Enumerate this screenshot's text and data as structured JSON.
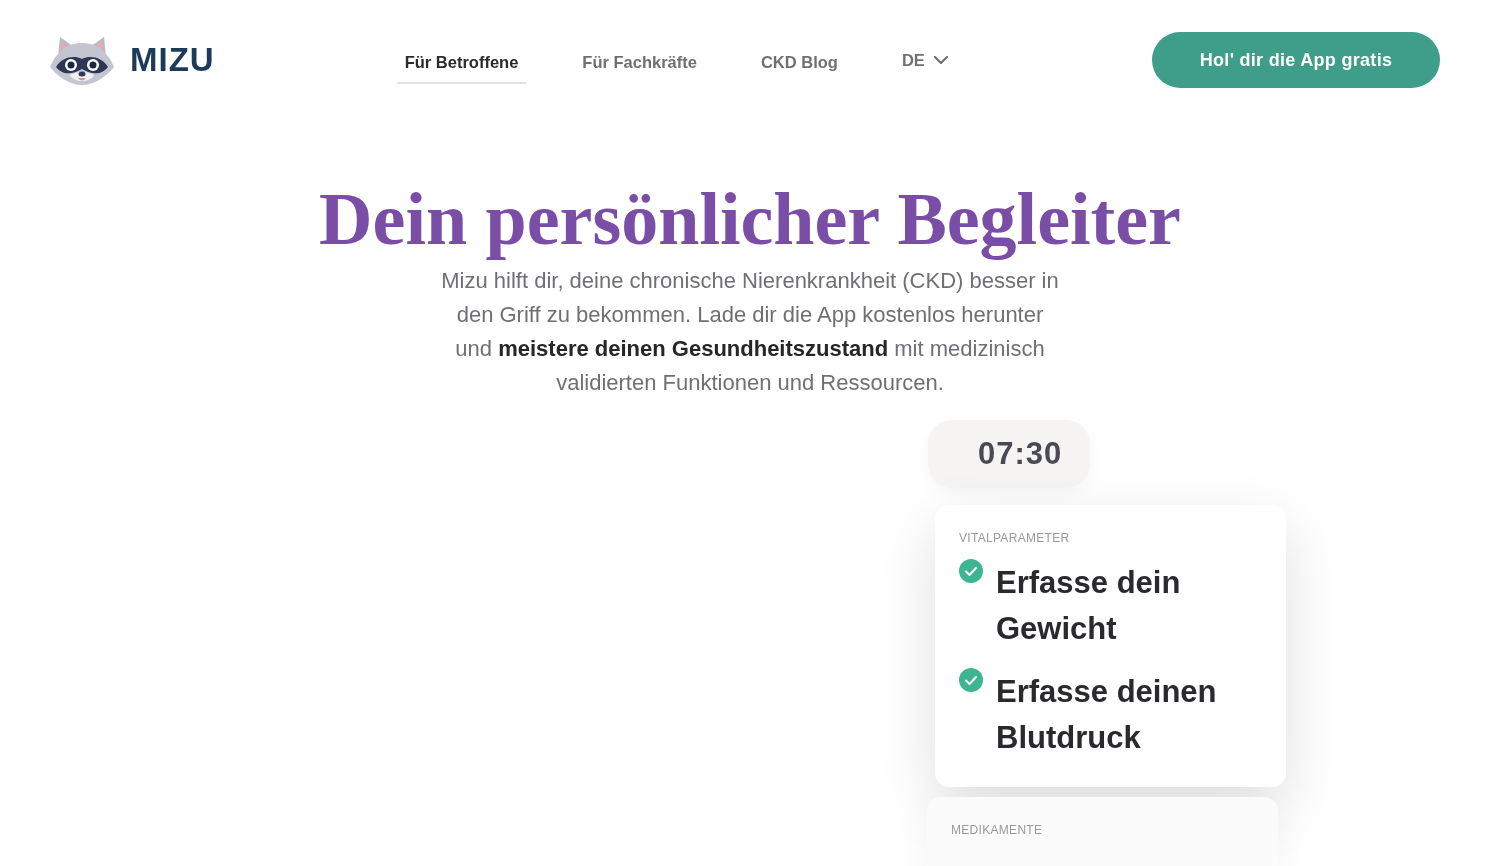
{
  "header": {
    "logo": {
      "text": "MIZU"
    },
    "nav": [
      {
        "label": "Für Betroffene",
        "selected": true
      },
      {
        "label": "Für Fachkräfte",
        "selected": false
      },
      {
        "label": "CKD Blog",
        "selected": false
      }
    ],
    "language": {
      "label": "DE"
    },
    "cta": {
      "label": "Hol' dir die App gratis"
    }
  },
  "hero": {
    "title": "Dein persönlicher Begleiter",
    "intro": "Mizu hilft dir, deine chronische Nierenkrankheit (CKD) besser in den Griff zu bekommen. Lade dir die App kostenlos herunter und **meistere deinen Gesundheitszustand** mit medizinisch validierten Funktionen und Ressourcen."
  },
  "phone": {
    "time": "07:30",
    "cards": [
      {
        "category": "VITALPARAMETER",
        "tasks": [
          {
            "label": "Erfasse dein Gewicht",
            "done": true
          },
          {
            "label": "Erfasse deinen Blutdruck",
            "done": true
          }
        ]
      },
      {
        "category": "MEDIKAMENTE"
      }
    ]
  }
}
